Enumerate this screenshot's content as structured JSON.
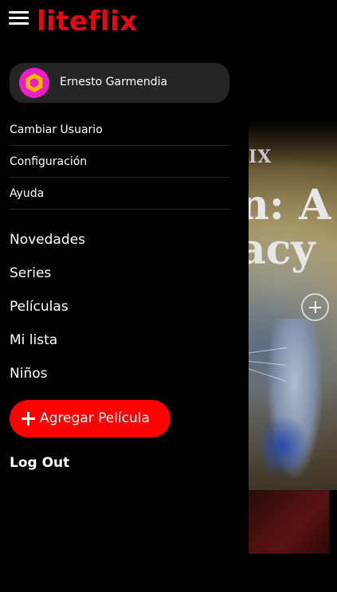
{
  "app": {
    "logo": "liteflix"
  },
  "profile": {
    "name": "Ernesto Garmendia"
  },
  "account_menu": [
    {
      "label": "Cambiar Usuario"
    },
    {
      "label": "Configuración"
    },
    {
      "label": "Ayuda"
    }
  ],
  "main_menu": [
    {
      "label": "Novedades"
    },
    {
      "label": "Series"
    },
    {
      "label": "Películas"
    },
    {
      "label": "Mi lista"
    },
    {
      "label": "Niños"
    }
  ],
  "actions": {
    "add_movie": "Agregar Película",
    "logout": "Log Out"
  },
  "background": {
    "brand_fragment": "IX",
    "title_line1": "n: A",
    "title_line2": "acy"
  },
  "colors": {
    "brand": "#e50914",
    "add_button": "#ff0000",
    "avatar": "#e91ec8",
    "profile_card": "#252525"
  }
}
